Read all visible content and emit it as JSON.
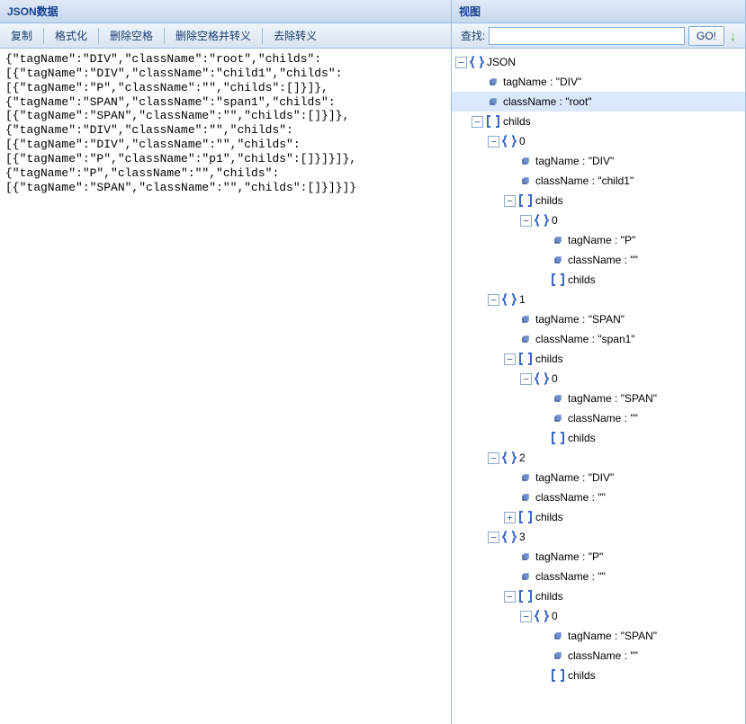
{
  "left": {
    "title": "JSON数据",
    "toolbar": {
      "copy": "复制",
      "format": "格式化",
      "trim": "删除空格",
      "trim_escape": "删除空格并转义",
      "unescape": "去除转义"
    },
    "lines": [
      "{\"tagName\":\"DIV\",\"className\":\"root\",\"childs\":",
      "[{\"tagName\":\"DIV\",\"className\":\"child1\",\"childs\":",
      "[{\"tagName\":\"P\",\"className\":\"\",\"childs\":[]}]},",
      "{\"tagName\":\"SPAN\",\"className\":\"span1\",\"childs\":",
      "[{\"tagName\":\"SPAN\",\"className\":\"\",\"childs\":[]}]},",
      "{\"tagName\":\"DIV\",\"className\":\"\",\"childs\":",
      "[{\"tagName\":\"DIV\",\"className\":\"\",\"childs\":",
      "[{\"tagName\":\"P\",\"className\":\"p1\",\"childs\":[]}]}]},",
      "{\"tagName\":\"P\",\"className\":\"\",\"childs\":",
      "[{\"tagName\":\"SPAN\",\"className\":\"\",\"childs\":[]}]}]}"
    ]
  },
  "right": {
    "title": "视图",
    "search_label": "查找:",
    "go_label": "GO!",
    "tree": [
      {
        "depth": 0,
        "toggle": "-",
        "icon": "braces",
        "label": "JSON",
        "name": "node-root"
      },
      {
        "depth": 1,
        "toggle": "",
        "icon": "cube",
        "label": "tagName : \"DIV\"",
        "name": "node-tagname"
      },
      {
        "depth": 1,
        "toggle": "",
        "icon": "cube",
        "label": "className : \"root\"",
        "name": "node-classname",
        "selected": true
      },
      {
        "depth": 1,
        "toggle": "-",
        "icon": "brackets",
        "label": "childs",
        "name": "node-childs"
      },
      {
        "depth": 2,
        "toggle": "-",
        "icon": "braces",
        "label": "0",
        "name": "node-index"
      },
      {
        "depth": 3,
        "toggle": "",
        "icon": "cube",
        "label": "tagName : \"DIV\"",
        "name": "node-tagname"
      },
      {
        "depth": 3,
        "toggle": "",
        "icon": "cube",
        "label": "className : \"child1\"",
        "name": "node-classname"
      },
      {
        "depth": 3,
        "toggle": "-",
        "icon": "brackets",
        "label": "childs",
        "name": "node-childs"
      },
      {
        "depth": 4,
        "toggle": "-",
        "icon": "braces",
        "label": "0",
        "name": "node-index"
      },
      {
        "depth": 5,
        "toggle": "",
        "icon": "cube",
        "label": "tagName : \"P\"",
        "name": "node-tagname"
      },
      {
        "depth": 5,
        "toggle": "",
        "icon": "cube",
        "label": "className : \"\"",
        "name": "node-classname"
      },
      {
        "depth": 5,
        "toggle": "",
        "icon": "brackets",
        "label": "childs",
        "name": "node-childs"
      },
      {
        "depth": 2,
        "toggle": "-",
        "icon": "braces",
        "label": "1",
        "name": "node-index"
      },
      {
        "depth": 3,
        "toggle": "",
        "icon": "cube",
        "label": "tagName : \"SPAN\"",
        "name": "node-tagname"
      },
      {
        "depth": 3,
        "toggle": "",
        "icon": "cube",
        "label": "className : \"span1\"",
        "name": "node-classname"
      },
      {
        "depth": 3,
        "toggle": "-",
        "icon": "brackets",
        "label": "childs",
        "name": "node-childs"
      },
      {
        "depth": 4,
        "toggle": "-",
        "icon": "braces",
        "label": "0",
        "name": "node-index"
      },
      {
        "depth": 5,
        "toggle": "",
        "icon": "cube",
        "label": "tagName : \"SPAN\"",
        "name": "node-tagname"
      },
      {
        "depth": 5,
        "toggle": "",
        "icon": "cube",
        "label": "className : \"\"",
        "name": "node-classname"
      },
      {
        "depth": 5,
        "toggle": "",
        "icon": "brackets",
        "label": "childs",
        "name": "node-childs"
      },
      {
        "depth": 2,
        "toggle": "-",
        "icon": "braces",
        "label": "2",
        "name": "node-index"
      },
      {
        "depth": 3,
        "toggle": "",
        "icon": "cube",
        "label": "tagName : \"DIV\"",
        "name": "node-tagname"
      },
      {
        "depth": 3,
        "toggle": "",
        "icon": "cube",
        "label": "className : \"\"",
        "name": "node-classname"
      },
      {
        "depth": 3,
        "toggle": "+",
        "icon": "brackets",
        "label": "childs",
        "name": "node-childs"
      },
      {
        "depth": 2,
        "toggle": "-",
        "icon": "braces",
        "label": "3",
        "name": "node-index"
      },
      {
        "depth": 3,
        "toggle": "",
        "icon": "cube",
        "label": "tagName : \"P\"",
        "name": "node-tagname"
      },
      {
        "depth": 3,
        "toggle": "",
        "icon": "cube",
        "label": "className : \"\"",
        "name": "node-classname"
      },
      {
        "depth": 3,
        "toggle": "-",
        "icon": "brackets",
        "label": "childs",
        "name": "node-childs"
      },
      {
        "depth": 4,
        "toggle": "-",
        "icon": "braces",
        "label": "0",
        "name": "node-index"
      },
      {
        "depth": 5,
        "toggle": "",
        "icon": "cube",
        "label": "tagName : \"SPAN\"",
        "name": "node-tagname"
      },
      {
        "depth": 5,
        "toggle": "",
        "icon": "cube",
        "label": "className : \"\"",
        "name": "node-classname"
      },
      {
        "depth": 5,
        "toggle": "",
        "icon": "brackets",
        "label": "childs",
        "name": "node-childs"
      }
    ]
  }
}
